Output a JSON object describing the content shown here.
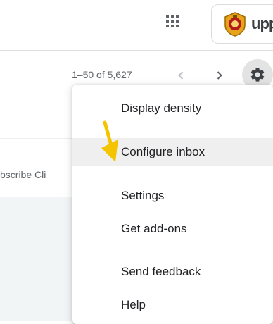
{
  "header": {
    "apps_icon": "apps-grid-icon",
    "account_text": "upp"
  },
  "toolbar": {
    "pager_text": "1–50 of 5,627",
    "prev_icon": "chevron-left-icon",
    "next_icon": "chevron-right-icon",
    "settings_icon": "gear-icon"
  },
  "list": {
    "partial_text": "bscribe Cli"
  },
  "settings_menu": {
    "items": [
      {
        "label": "Display density"
      },
      {
        "label": "Configure inbox"
      },
      {
        "label": "Settings"
      },
      {
        "label": "Get add-ons"
      },
      {
        "label": "Send feedback"
      },
      {
        "label": "Help"
      }
    ],
    "highlighted_item": "Configure inbox"
  },
  "annotation": {
    "arrow_color": "#f5c400"
  },
  "colors": {
    "menu_hover": "#efefef",
    "gear_button_bg": "#e3e3e3",
    "list_bg": "#f2f5f5"
  }
}
